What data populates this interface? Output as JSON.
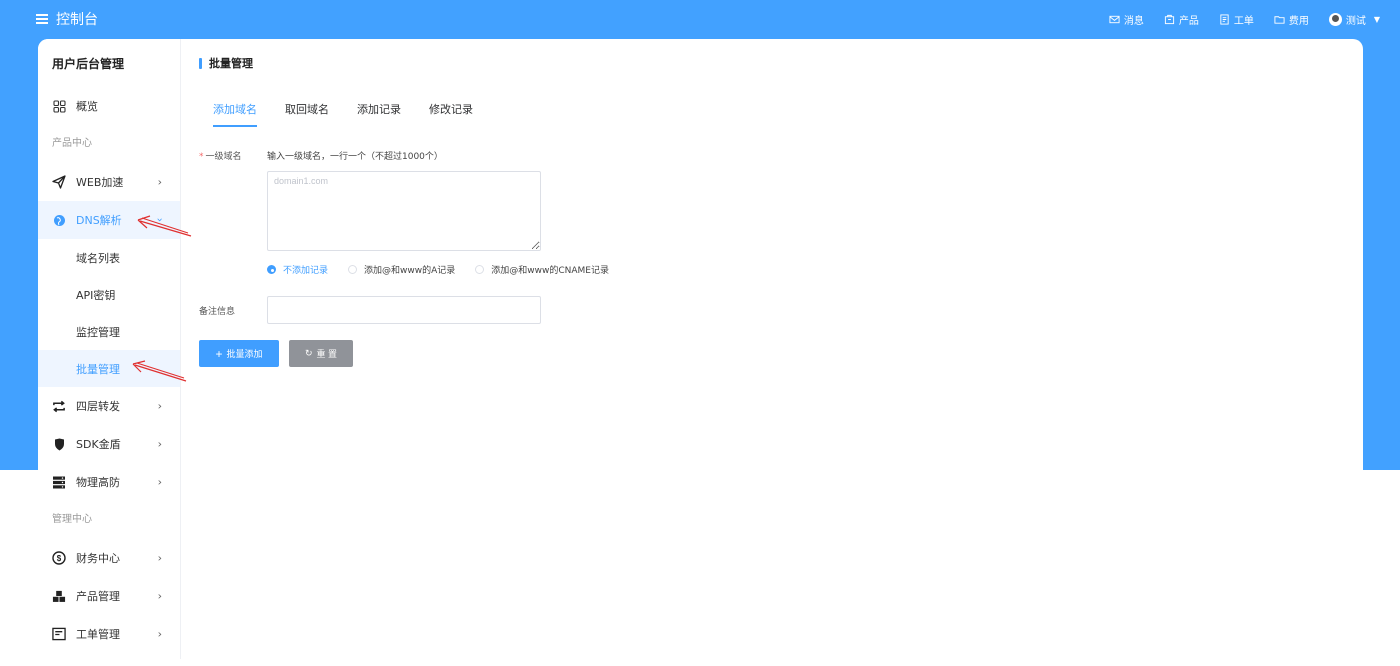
{
  "colors": {
    "accent": "#409eff",
    "band": "#42a1ff",
    "annotation_arrow": "#e03030"
  },
  "topbar": {
    "title": "控制台",
    "nav": [
      {
        "icon": "mail-icon",
        "label": "消息"
      },
      {
        "icon": "package-icon",
        "label": "产品"
      },
      {
        "icon": "ticket-icon",
        "label": "工单"
      },
      {
        "icon": "folder-icon",
        "label": "费用"
      }
    ],
    "user": "测试"
  },
  "sidebar": {
    "title": "用户后台管理",
    "overview": "概览",
    "group_product": "产品中心",
    "web_accel": "WEB加速",
    "dns": "DNS解析",
    "dns_sub": [
      "域名列表",
      "API密钥",
      "监控管理",
      "批量管理"
    ],
    "l4_forward": "四层转发",
    "sdk_shield": "SDK金盾",
    "physical_defense": "物理高防",
    "group_manage": "管理中心",
    "finance": "财务中心",
    "product_manage": "产品管理",
    "ticket_manage": "工单管理"
  },
  "main": {
    "page_title": "批量管理",
    "tabs": [
      "添加域名",
      "取回域名",
      "添加记录",
      "修改记录"
    ],
    "form": {
      "domain_label": "一级域名",
      "domain_hint": "输入一级域名，一行一个（不超过1000个）",
      "domain_placeholder": "domain1.com",
      "radio_options": [
        "不添加记录",
        "添加@和www的A记录",
        "添加@和www的CNAME记录"
      ],
      "note_label": "备注信息",
      "note_value": "",
      "submit_label": "批量添加",
      "reset_label": "重 置"
    }
  }
}
